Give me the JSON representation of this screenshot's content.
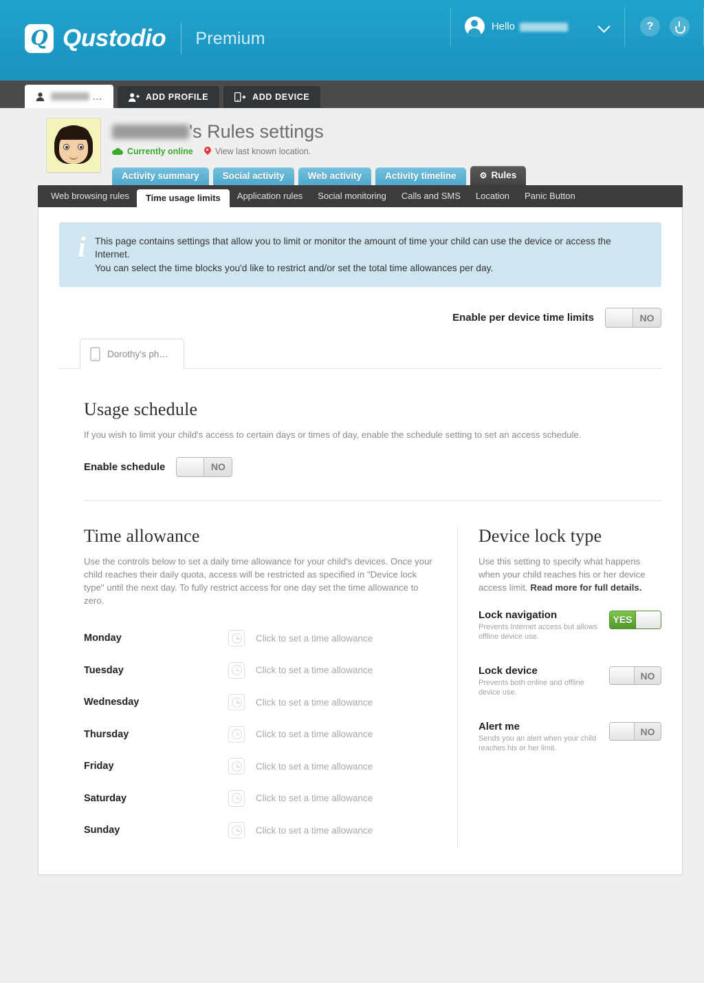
{
  "brand": {
    "mark": "Q",
    "name": "Qustodio",
    "plan": "Premium"
  },
  "account": {
    "greeting": "Hello",
    "name_redacted": "",
    "help_label": "?",
    "caret_icon": "chevron-down-icon",
    "power_icon": "power-icon"
  },
  "profile_tabs": {
    "current_profile_label": "",
    "current_profile_dots": "...",
    "add_profile": "ADD PROFILE",
    "add_device": "ADD DEVICE"
  },
  "profile_header": {
    "title_suffix": "'s Rules settings",
    "status_online": "Currently online",
    "location_link": "View last known location."
  },
  "main_tabs": [
    {
      "label": "Activity summary",
      "active": false
    },
    {
      "label": "Social activity",
      "active": false
    },
    {
      "label": "Web activity",
      "active": false
    },
    {
      "label": "Activity timeline",
      "active": false
    },
    {
      "label": "Rules",
      "active": true,
      "icon": "gear-icon"
    }
  ],
  "sub_tabs": [
    {
      "label": "Web browsing rules",
      "active": false
    },
    {
      "label": "Time usage limits",
      "active": true
    },
    {
      "label": "Application rules",
      "active": false
    },
    {
      "label": "Social monitoring",
      "active": false
    },
    {
      "label": "Calls and SMS",
      "active": false
    },
    {
      "label": "Location",
      "active": false
    },
    {
      "label": "Panic Button",
      "active": false
    }
  ],
  "banner": {
    "icon": "info-icon",
    "line1": "This page contains settings that allow you to limit or monitor the amount of time your child can use the device or access the Internet.",
    "line2": "You can select the time blocks you'd like to restrict and/or set the total time allowances per day."
  },
  "per_device": {
    "label": "Enable per device time limits",
    "value": "NO",
    "state": "off"
  },
  "device_tab": {
    "label": "Dorothy's ph…",
    "icon": "phone-icon"
  },
  "usage_schedule": {
    "title": "Usage schedule",
    "description": "If you wish to limit your child's access to certain days or times of day, enable the schedule setting to set an access schedule.",
    "toggle_label": "Enable schedule",
    "toggle_value": "NO",
    "toggle_state": "off"
  },
  "time_allowance": {
    "title": "Time allowance",
    "description": "Use the controls below to set a daily time allowance for your child's devices. Once your child reaches their daily quota, access will be restricted as specified in \"Device lock type\" until the next day. To fully restrict access for one day set the time allowance to zero.",
    "hint": "Click to set a time allowance",
    "days": [
      {
        "name": "Monday",
        "value": "Click to set a time allowance"
      },
      {
        "name": "Tuesday",
        "value": "Click to set a time allowance"
      },
      {
        "name": "Wednesday",
        "value": "Click to set a time allowance"
      },
      {
        "name": "Thursday",
        "value": "Click to set a time allowance"
      },
      {
        "name": "Friday",
        "value": "Click to set a time allowance"
      },
      {
        "name": "Saturday",
        "value": "Click to set a time allowance"
      },
      {
        "name": "Sunday",
        "value": "Click to set a time allowance"
      }
    ]
  },
  "device_lock": {
    "title": "Device lock type",
    "description_part1": "Use this setting to specify what happens when your child reaches his or her device access limit. ",
    "description_link": "Read more for full details.",
    "options": [
      {
        "title": "Lock navigation",
        "subtitle": "Prevents Internet access but allows offline device use.",
        "value": "YES",
        "state": "on"
      },
      {
        "title": "Lock device",
        "subtitle": "Prevents both online and offline device use.",
        "value": "NO",
        "state": "off"
      },
      {
        "title": "Alert me",
        "subtitle": "Sends you an alert when your child reaches his or her limit.",
        "value": "NO",
        "state": "off"
      }
    ]
  },
  "colors": {
    "brand_blue": "#1b93bd",
    "tab_blue": "#4fa8cb",
    "dark_nav": "#3a3c3e",
    "banner_blue": "#cfe5f0",
    "toggle_green": "#5fae2d",
    "online_green": "#3aab2e",
    "page_bg": "#efefef"
  }
}
